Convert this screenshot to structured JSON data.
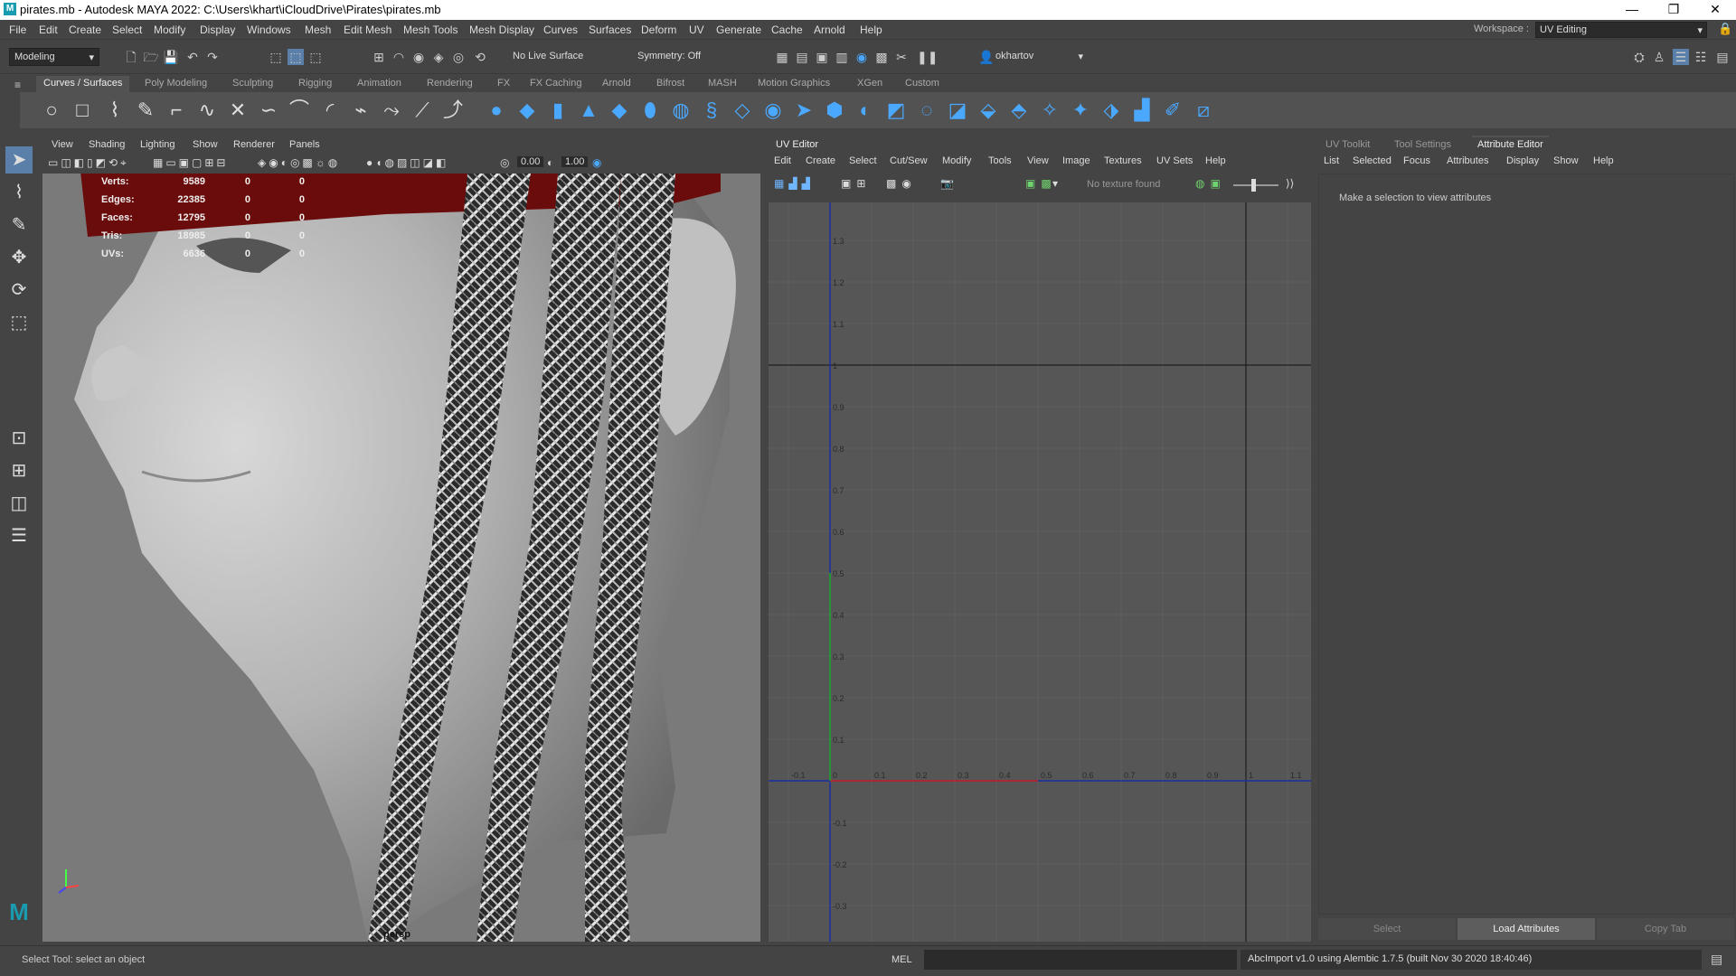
{
  "window": {
    "title": "pirates.mb - Autodesk MAYA 2022: C:\\Users\\khart\\iCloudDrive\\Pirates\\pirates.mb",
    "minimize": "—",
    "restore": "❐",
    "close": "✕"
  },
  "menubar": {
    "items": [
      "File",
      "Edit",
      "Create",
      "Select",
      "Modify",
      "Display",
      "Windows",
      "Mesh",
      "Edit Mesh",
      "Mesh Tools",
      "Mesh Display",
      "Curves",
      "Surfaces",
      "Deform",
      "UV",
      "Generate",
      "Cache",
      "Arnold",
      "Help"
    ],
    "workspace_label": "Workspace :",
    "workspace_value": "UV Editing"
  },
  "statusline": {
    "mode": "Modeling",
    "live_surface": "No Live Surface",
    "symmetry": "Symmetry: Off",
    "user": "okhartov"
  },
  "shelf": {
    "tabs": [
      "Curves / Surfaces",
      "Poly Modeling",
      "Sculpting",
      "Rigging",
      "Animation",
      "Rendering",
      "FX",
      "FX Caching",
      "Arnold",
      "Bifrost",
      "MASH",
      "Motion Graphics",
      "XGen",
      "Custom"
    ],
    "active": "Curves / Surfaces"
  },
  "viewport": {
    "menu": [
      "View",
      "Shading",
      "Lighting",
      "Show",
      "Renderer",
      "Panels"
    ],
    "field1": "0.00",
    "field2": "1.00",
    "camera": "persp",
    "hud": [
      {
        "label": "Verts:",
        "a": "9589",
        "b": "0",
        "c": "0"
      },
      {
        "label": "Edges:",
        "a": "22385",
        "b": "0",
        "c": "0"
      },
      {
        "label": "Faces:",
        "a": "12795",
        "b": "0",
        "c": "0"
      },
      {
        "label": "Tris:",
        "a": "18985",
        "b": "0",
        "c": "0"
      },
      {
        "label": "UVs:",
        "a": "6636",
        "b": "0",
        "c": "0"
      }
    ],
    "colors": {
      "band": "#6b0c0c",
      "bg": "#7a7a7a"
    }
  },
  "uv_editor": {
    "title": "UV Editor",
    "menu": [
      "Edit",
      "Create",
      "Select",
      "Cut/Sew",
      "Modify",
      "Tools",
      "View",
      "Image",
      "Textures",
      "UV Sets",
      "Help"
    ],
    "no_texture": "No texture found",
    "x_ticks": [
      "-0.1",
      "0",
      "0.1",
      "0.2",
      "0.3",
      "0.4",
      "0.5",
      "0.6",
      "0.7",
      "0.8",
      "0.9",
      "1",
      "1.1"
    ],
    "y_ticks": [
      "1.3",
      "1.2",
      "1.1",
      "1",
      "0.9",
      "0.8",
      "0.7",
      "0.6",
      "0.5",
      "0.4",
      "0.3",
      "0.2",
      "0.1",
      "0",
      "-0.1",
      "-0.2",
      "-0.3",
      "-0.4"
    ]
  },
  "attribute_editor": {
    "tabs": [
      "UV Toolkit",
      "Tool Settings",
      "Attribute Editor"
    ],
    "active": "Attribute Editor",
    "menu": [
      "List",
      "Selected",
      "Focus",
      "Attributes",
      "Display",
      "Show",
      "Help"
    ],
    "message": "Make a selection to view attributes",
    "buttons": [
      "Select",
      "Load Attributes",
      "Copy Tab"
    ]
  },
  "bottom": {
    "help": "Select Tool: select an object",
    "lang": "MEL",
    "result": "AbcImport v1.0 using Alembic 1.7.5 (built Nov 30 2020 18:40:46)"
  }
}
